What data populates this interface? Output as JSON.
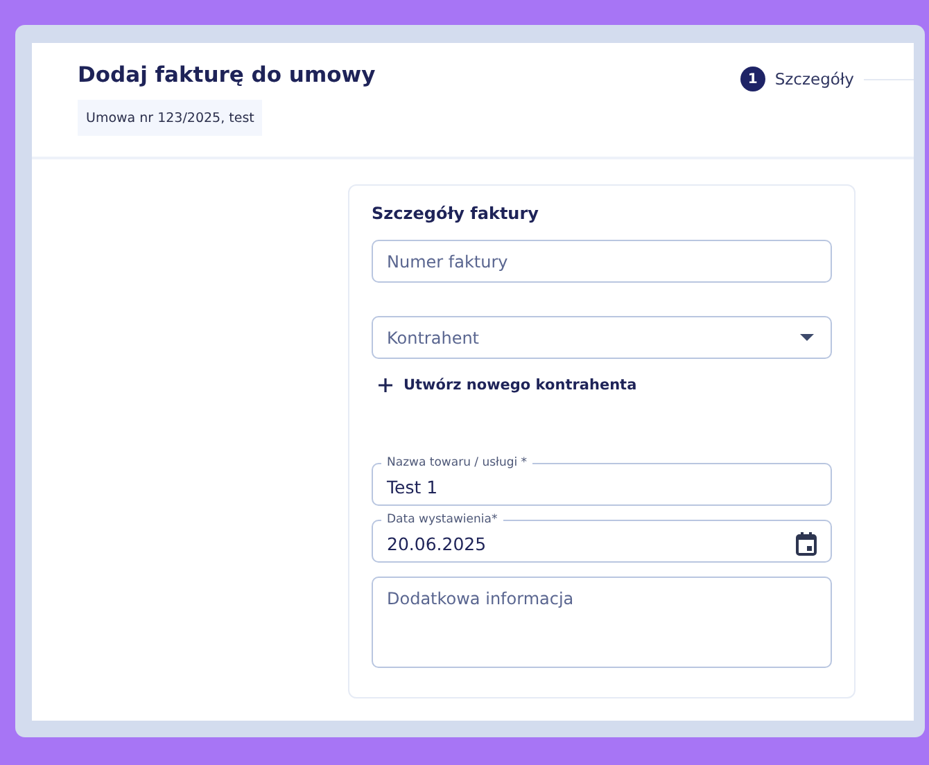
{
  "header": {
    "title": "Dodaj fakturę do umowy",
    "contract_tag": "Umowa nr 123/2025, test"
  },
  "stepper": {
    "steps": [
      {
        "number": "1",
        "label": "Szczegóły",
        "selected": true
      }
    ]
  },
  "form": {
    "title": "Szczegóły faktury",
    "fields": [
      {
        "kind": "text",
        "placeholder": "Numer faktury"
      },
      {
        "kind": "select",
        "placeholder": "Kontrahent"
      },
      {
        "kind": "link",
        "label": "Utwórz nowego kontrahenta"
      },
      {
        "kind": "text",
        "label": "Nazwa towaru / usługi *",
        "value": "Test 1"
      },
      {
        "kind": "date",
        "label": "Data wystawienia*",
        "value": "20.06.2025"
      },
      {
        "kind": "textarea",
        "placeholder": "Dodatkowa informacja"
      }
    ]
  }
}
